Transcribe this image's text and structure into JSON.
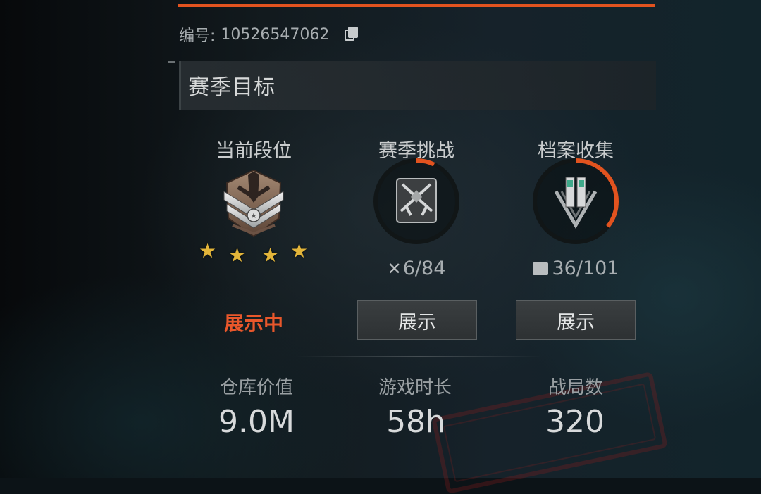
{
  "profile": {
    "id_label": "编号:",
    "id_value": "10526547062"
  },
  "section": {
    "title": "赛季目标"
  },
  "columns": {
    "rank": {
      "title": "当前段位",
      "stars": 4,
      "status": "展示中"
    },
    "season_challenge": {
      "title": "赛季挑战",
      "progress": "6/84",
      "progress_fraction": 0.071,
      "button": "展示"
    },
    "archive_collection": {
      "title": "档案收集",
      "progress": "36/101",
      "progress_fraction": 0.356,
      "button": "展示"
    }
  },
  "stats": [
    {
      "label": "仓库价值",
      "value": "9.0M"
    },
    {
      "label": "游戏时长",
      "value": "58h"
    },
    {
      "label": "战局数",
      "value": "320"
    }
  ],
  "colors": {
    "accent": "#e2531f",
    "status": "#e8572b",
    "star": "#e3b53a"
  }
}
